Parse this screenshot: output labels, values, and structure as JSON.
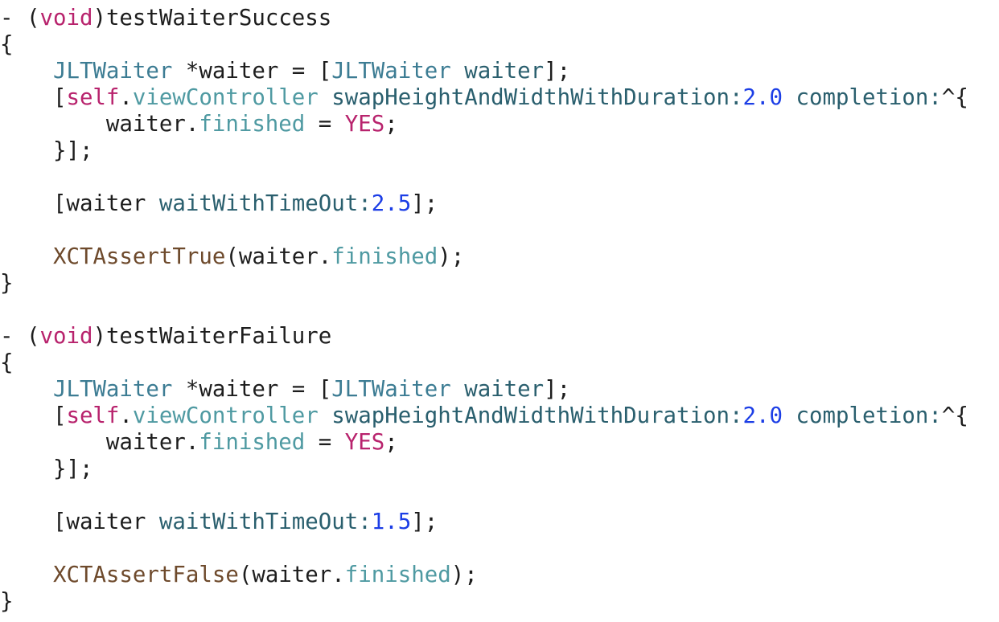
{
  "code_lines": [
    [
      [
        "- (",
        "plain"
      ],
      [
        "void",
        "kw"
      ],
      [
        ")testWaiterSuccess",
        "plain"
      ]
    ],
    [
      [
        "{",
        "plain"
      ]
    ],
    [
      [
        "    ",
        "plain"
      ],
      [
        "JLTWaiter",
        "type"
      ],
      [
        " *waiter = [",
        "plain"
      ],
      [
        "JLTWaiter",
        "type"
      ],
      [
        " ",
        "plain"
      ],
      [
        "waiter",
        "method"
      ],
      [
        "];",
        "plain"
      ]
    ],
    [
      [
        "    [",
        "plain"
      ],
      [
        "self",
        "kw"
      ],
      [
        ".",
        "plain"
      ],
      [
        "viewController",
        "prop"
      ],
      [
        " ",
        "plain"
      ],
      [
        "swapHeightAndWidthWithDuration:",
        "method"
      ],
      [
        "2.0",
        "num"
      ],
      [
        " ",
        "plain"
      ],
      [
        "completion:",
        "method"
      ],
      [
        "^{",
        "plain"
      ]
    ],
    [
      [
        "        waiter.",
        "plain"
      ],
      [
        "finished",
        "prop"
      ],
      [
        " = ",
        "plain"
      ],
      [
        "YES",
        "kw"
      ],
      [
        ";",
        "plain"
      ]
    ],
    [
      [
        "    }];",
        "plain"
      ]
    ],
    [],
    [
      [
        "    [waiter ",
        "plain"
      ],
      [
        "waitWithTimeOut:",
        "method"
      ],
      [
        "2.5",
        "num"
      ],
      [
        "];",
        "plain"
      ]
    ],
    [],
    [
      [
        "    ",
        "plain"
      ],
      [
        "XCTAssertTrue",
        "macro"
      ],
      [
        "(waiter.",
        "plain"
      ],
      [
        "finished",
        "prop"
      ],
      [
        ");",
        "plain"
      ]
    ],
    [
      [
        "}",
        "plain"
      ]
    ],
    [],
    [
      [
        "- (",
        "plain"
      ],
      [
        "void",
        "kw"
      ],
      [
        ")testWaiterFailure",
        "plain"
      ]
    ],
    [
      [
        "{",
        "plain"
      ]
    ],
    [
      [
        "    ",
        "plain"
      ],
      [
        "JLTWaiter",
        "type"
      ],
      [
        " *waiter = [",
        "plain"
      ],
      [
        "JLTWaiter",
        "type"
      ],
      [
        " ",
        "plain"
      ],
      [
        "waiter",
        "method"
      ],
      [
        "];",
        "plain"
      ]
    ],
    [
      [
        "    [",
        "plain"
      ],
      [
        "self",
        "kw"
      ],
      [
        ".",
        "plain"
      ],
      [
        "viewController",
        "prop"
      ],
      [
        " ",
        "plain"
      ],
      [
        "swapHeightAndWidthWithDuration:",
        "method"
      ],
      [
        "2.0",
        "num"
      ],
      [
        " ",
        "plain"
      ],
      [
        "completion:",
        "method"
      ],
      [
        "^{",
        "plain"
      ]
    ],
    [
      [
        "        waiter.",
        "plain"
      ],
      [
        "finished",
        "prop"
      ],
      [
        " = ",
        "plain"
      ],
      [
        "YES",
        "kw"
      ],
      [
        ";",
        "plain"
      ]
    ],
    [
      [
        "    }];",
        "plain"
      ]
    ],
    [],
    [
      [
        "    [waiter ",
        "plain"
      ],
      [
        "waitWithTimeOut:",
        "method"
      ],
      [
        "1.5",
        "num"
      ],
      [
        "];",
        "plain"
      ]
    ],
    [],
    [
      [
        "    ",
        "plain"
      ],
      [
        "XCTAssertFalse",
        "macro"
      ],
      [
        "(waiter.",
        "plain"
      ],
      [
        "finished",
        "prop"
      ],
      [
        ");",
        "plain"
      ]
    ],
    [
      [
        "}",
        "plain"
      ]
    ]
  ],
  "syntax_colors": {
    "plain": "#1d1d1d",
    "kw": "#b8236d",
    "type": "#3c7c93",
    "method": "#2a5f6e",
    "prop": "#4f9aa2",
    "num": "#1c3ee6",
    "macro": "#6e4a2c"
  }
}
